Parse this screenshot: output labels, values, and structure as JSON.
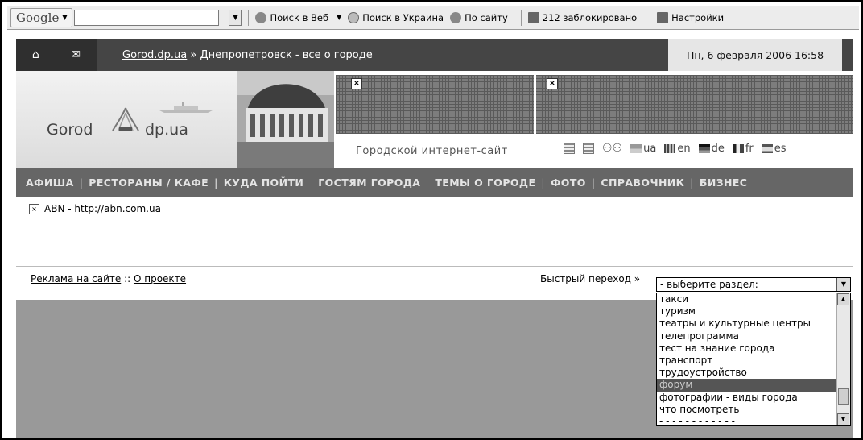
{
  "toolbar": {
    "logo": "Google",
    "search_value": "",
    "items": [
      {
        "label": "Поиск в Веб",
        "icon": "binoculars-icon"
      },
      {
        "label": "Поиск в Украина",
        "icon": "globe-icon"
      },
      {
        "label": "По сайту",
        "icon": "site-search-icon"
      },
      {
        "label": "212 заблокировано",
        "icon": "popup-block-icon"
      },
      {
        "label": "Настройки",
        "icon": "settings-icon"
      }
    ]
  },
  "site": {
    "breadcrumb_link": "Gorod.dp.ua",
    "breadcrumb_rest": " » Днепропетровск - все о городе",
    "date": "Пн, 6 февраля 2006 16:58",
    "logo_text_left": "Gorod",
    "logo_text_right": "dp.ua",
    "tagline": "Городской интернет-сайт",
    "languages": [
      {
        "code": "ua",
        "color": "#aaaaaa"
      },
      {
        "code": "en",
        "color": "#555555"
      },
      {
        "code": "de",
        "color": "#222222"
      },
      {
        "code": "fr",
        "color": "#444444"
      },
      {
        "code": "es",
        "color": "#666666"
      }
    ],
    "nav": {
      "afisha": "АФИША",
      "restaurants": "РЕСТОРАНЫ / КАФЕ",
      "where_to_go": "КУДА ПОЙТИ",
      "guests": "ГОСТЯМ ГОРОДА",
      "themes": "ТЕМЫ О ГОРОДЕ",
      "photo": "ФОТО",
      "directory": "СПРАВОЧНИК",
      "business": "БИЗНЕС"
    },
    "abn_text": "ABN - http://abn.com.ua",
    "footer_ad": "Реклама на сайте",
    "footer_sep": " :: ",
    "footer_about": "О проекте",
    "quick_jump": "Быстрый переход »",
    "select_value": "- выберите раздел:",
    "options": [
      "такси",
      "туризм",
      "театры и культурные центры",
      "телепрограмма",
      "тест на знание города",
      "транспорт",
      "трудоустройство",
      "форум",
      "фотографии - виды города",
      "что посмотреть",
      "- - - - - - - - - - - -"
    ],
    "selected_option_index": 7
  }
}
